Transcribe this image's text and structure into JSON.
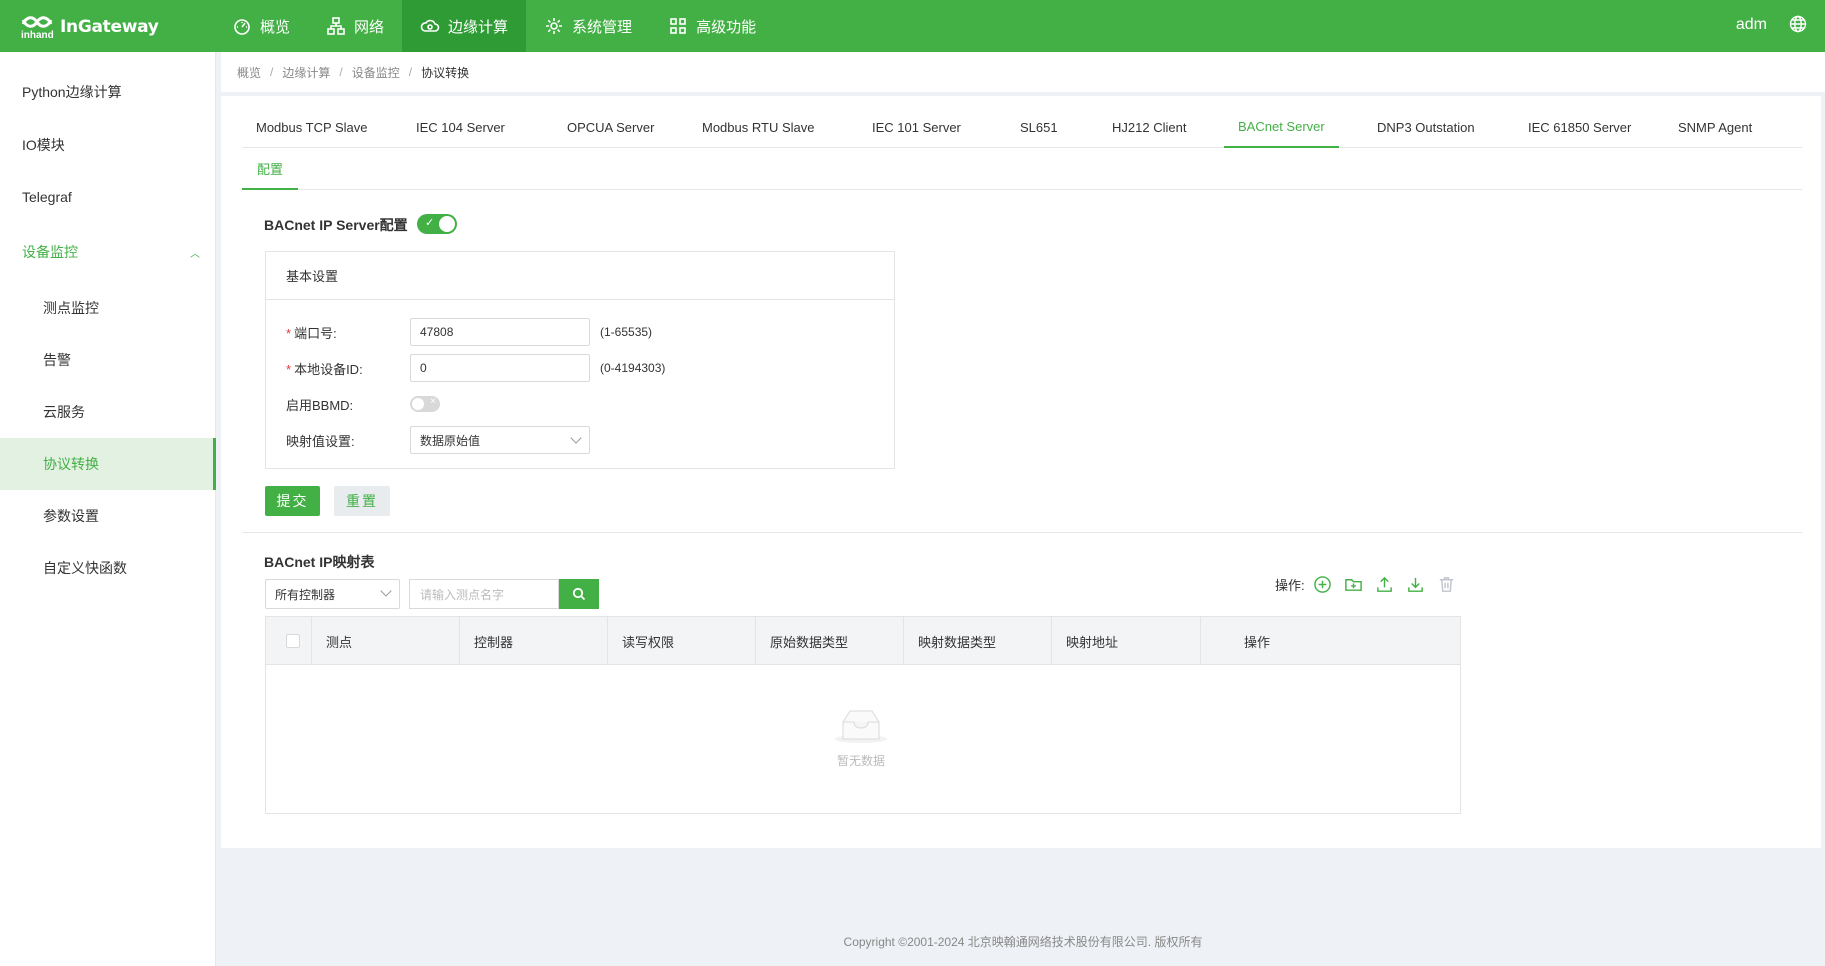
{
  "brand": {
    "name": "InGateway",
    "sub": "inhand"
  },
  "topnav": [
    {
      "label": "概览",
      "icon": "dashboard-icon"
    },
    {
      "label": "网络",
      "icon": "network-icon"
    },
    {
      "label": "边缘计算",
      "icon": "cloud-compute-icon"
    },
    {
      "label": "系统管理",
      "icon": "gear-icon"
    },
    {
      "label": "高级功能",
      "icon": "grid-icon"
    }
  ],
  "user": "adm",
  "sidebar": {
    "items": [
      {
        "label": "Python边缘计算"
      },
      {
        "label": "IO模块"
      },
      {
        "label": "Telegraf"
      },
      {
        "label": "设备监控"
      },
      {
        "label": "测点监控"
      },
      {
        "label": "告警"
      },
      {
        "label": "云服务"
      },
      {
        "label": "协议转换"
      },
      {
        "label": "参数设置"
      },
      {
        "label": "自定义快函数"
      }
    ]
  },
  "breadcrumb": [
    "概览",
    "边缘计算",
    "设备监控",
    "协议转换"
  ],
  "tabs": [
    "Modbus TCP Slave",
    "IEC 104 Server",
    "OPCUA Server",
    "Modbus RTU Slave",
    "IEC 101 Server",
    "SL651",
    "HJ212 Client",
    "BACnet Server",
    "DNP3 Outstation",
    "IEC 61850 Server",
    "SNMP Agent"
  ],
  "active_tab": "BACnet Server",
  "subtab": "配置",
  "config": {
    "title": "BACnet IP Server配置",
    "enabled": true,
    "panel_title": "基本设置",
    "port": {
      "label": "端口号:",
      "value": "47808",
      "hint": "(1-65535)"
    },
    "device_id": {
      "label": "本地设备ID:",
      "value": "0",
      "hint": "(0-4194303)"
    },
    "bbmd": {
      "label": "启用BBMD:",
      "enabled": false
    },
    "mapping": {
      "label": "映射值设置:",
      "value": "数据原始值"
    },
    "submit": "提交",
    "reset": "重置"
  },
  "map_table": {
    "title": "BACnet IP映射表",
    "controller_select": "所有控制器",
    "search_placeholder": "请输入测点名字",
    "ops_label": "操作:",
    "columns": [
      "测点",
      "控制器",
      "读写权限",
      "原始数据类型",
      "映射数据类型",
      "映射地址",
      "操作"
    ],
    "empty_text": "暂无数据"
  },
  "footer": "Copyright ©2001-2024 北京映翰通网络技术股份有限公司. 版权所有",
  "colors": {
    "primary": "#43b046",
    "primary_dark": "#2e9b34",
    "active_bg": "#e3f1e2",
    "danger": "#e23c39"
  }
}
